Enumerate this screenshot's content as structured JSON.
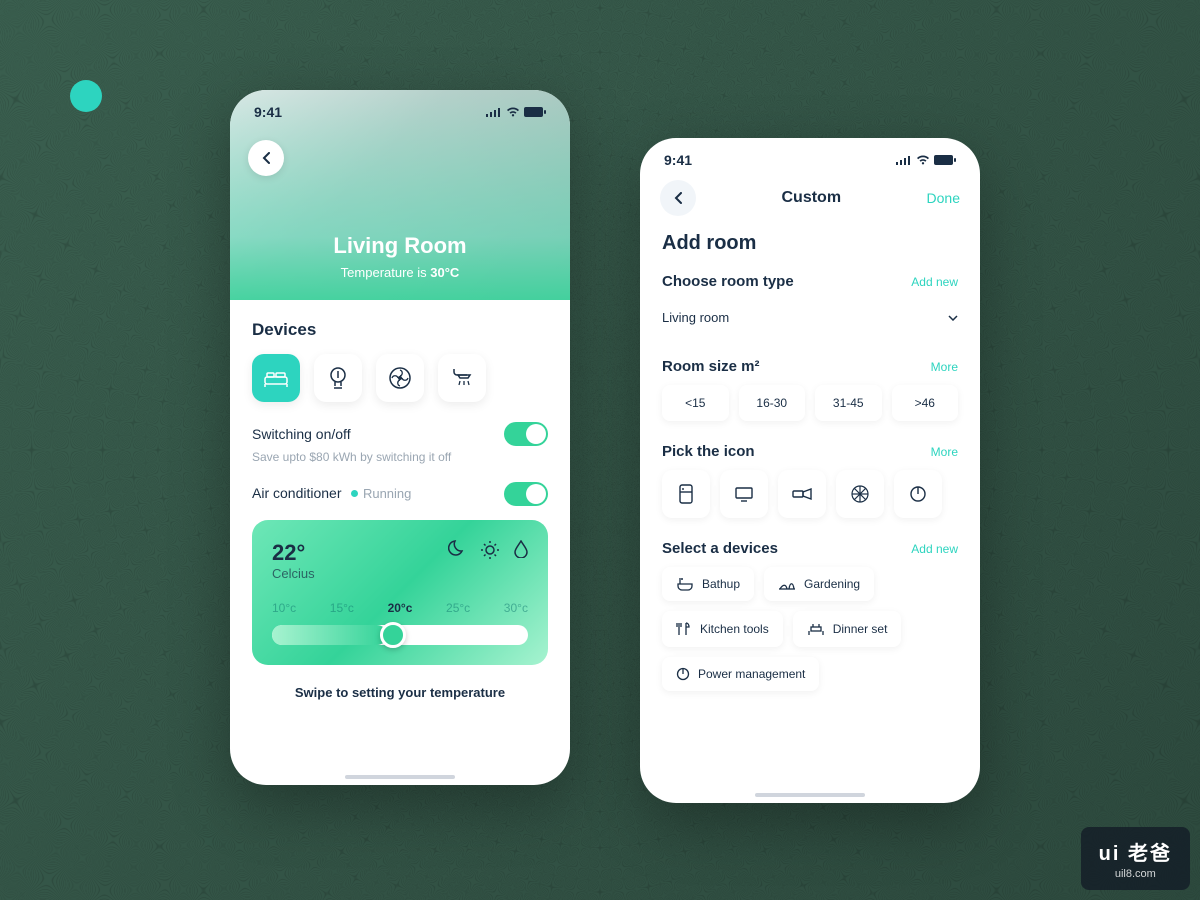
{
  "status": {
    "time": "9:41"
  },
  "screen1": {
    "room_name": "Living Room",
    "temp_prefix": "Temperature is ",
    "temp_value": "30°C",
    "devices_title": "Devices",
    "switch_label": "Switching on/off",
    "switch_sub": "Save upto $80 kWh by switching it off",
    "ac_label": "Air conditioner",
    "ac_status": "Running",
    "temp_card": {
      "value": "22°",
      "unit": "Celcius",
      "scale": [
        "10°c",
        "15°c",
        "20°c",
        "25°c",
        "30°c"
      ]
    },
    "swipe_hint": "Swipe to setting your temperature"
  },
  "screen2": {
    "header_title": "Custom",
    "done": "Done",
    "h1": "Add room",
    "room_type_label": "Choose room type",
    "add_new": "Add new",
    "room_type_value": "Living room",
    "room_size_label": "Room size m²",
    "more": "More",
    "sizes": [
      "<15",
      "16-30",
      "31-45",
      ">46"
    ],
    "pick_icon_label": "Pick the icon",
    "select_devices_label": "Select a devices",
    "devices": [
      "Bathup",
      "Gardening",
      "Kitchen tools",
      "Dinner set",
      "Power management"
    ]
  },
  "watermark": {
    "brand": "ui 老爸",
    "url": "uil8.com"
  }
}
